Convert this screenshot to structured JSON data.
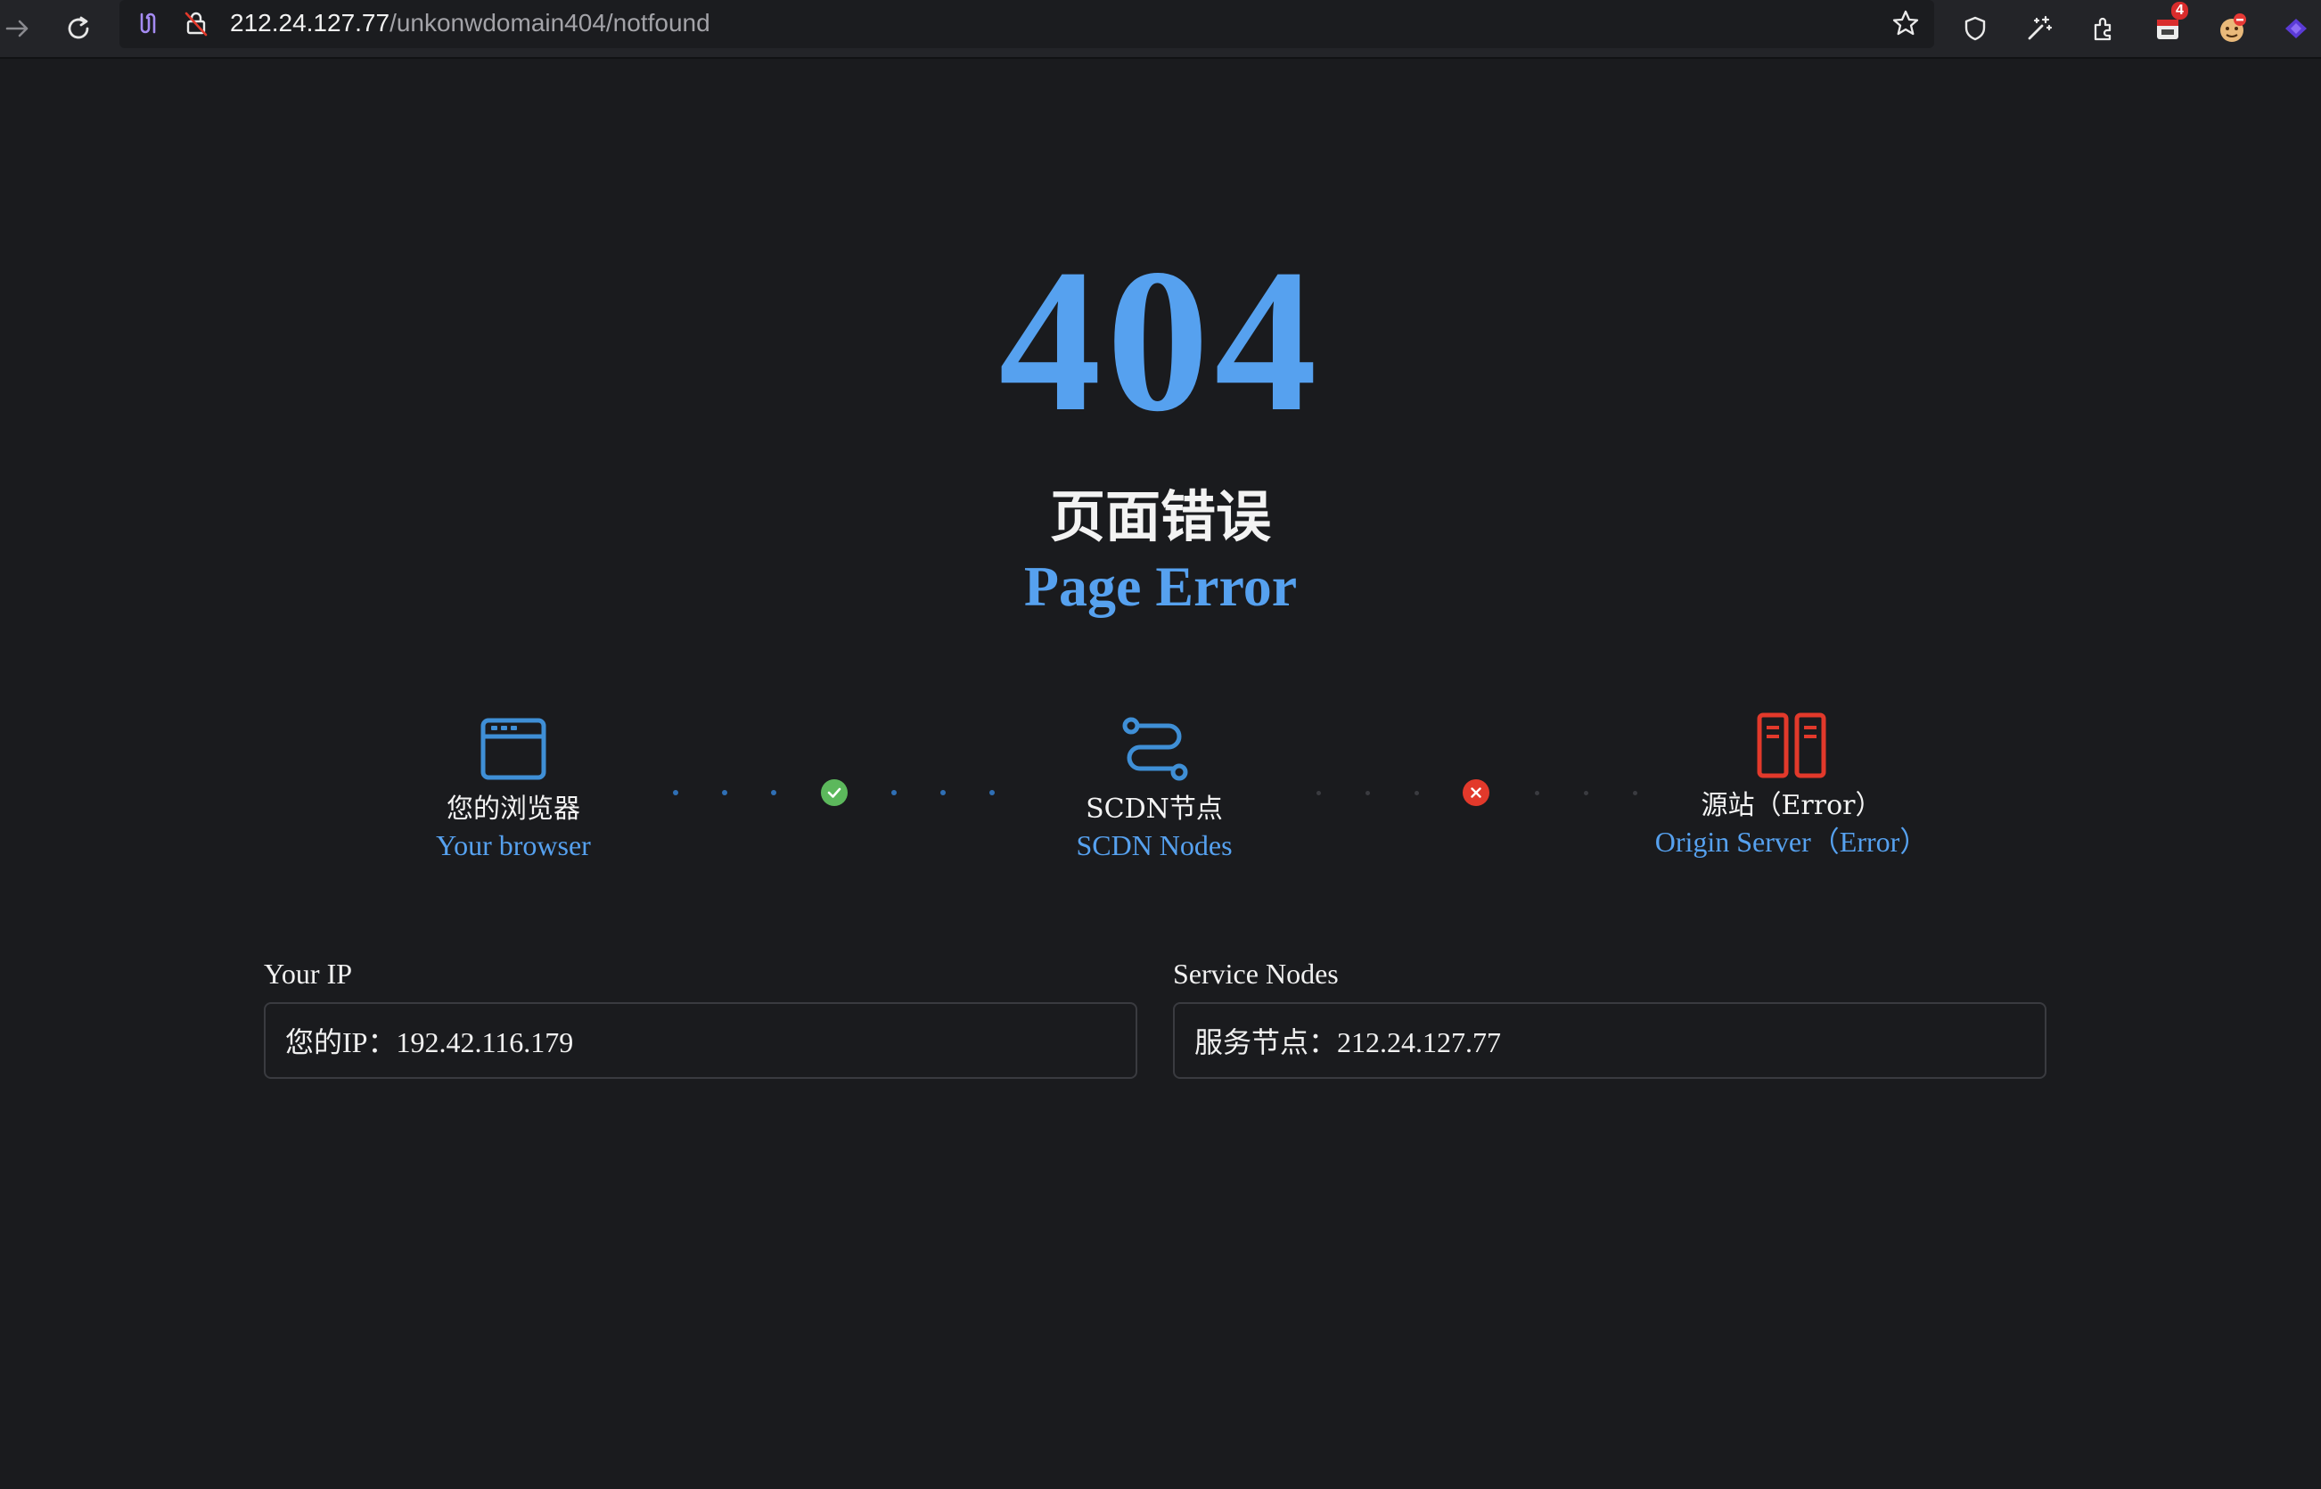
{
  "browser": {
    "url_host": "212.24.127.77",
    "url_path": "/unkonwdomain404/notfound",
    "extension_badge": "4",
    "icons": [
      "forward-icon",
      "reload-icon",
      "site-permissions-icon",
      "insecure-lock-icon",
      "bookmark-star-icon",
      "shield-icon",
      "magic-wand-icon",
      "extensions-puzzle-icon",
      "calendar-extension-icon",
      "avatar-extension-icon",
      "purple-extension-icon"
    ]
  },
  "page": {
    "code": "404",
    "title_cn": "页面错误",
    "title_en": "Page Error"
  },
  "path": {
    "browser": {
      "label_cn": "您的浏览器",
      "label_en": "Your browser",
      "icon": "browser-window-icon",
      "color": "#3f8fd6"
    },
    "scdn": {
      "label_cn": "SCDN节点",
      "label_en": "SCDN Nodes",
      "icon": "route-icon",
      "color": "#3f8fd6"
    },
    "origin": {
      "label_cn": "源站（Error）",
      "label_en": "Origin Server（Error）",
      "icon": "server-icon",
      "color": "#e2392b"
    },
    "link1_status": "ok",
    "link2_status": "error",
    "ok_color": "#5cb85c",
    "error_color": "#e2392b"
  },
  "info": {
    "ip_label": "Your IP",
    "ip_value": "您的IP：192.42.116.179",
    "nodes_label": "Service Nodes",
    "nodes_value": "服务节点：212.24.127.77"
  }
}
